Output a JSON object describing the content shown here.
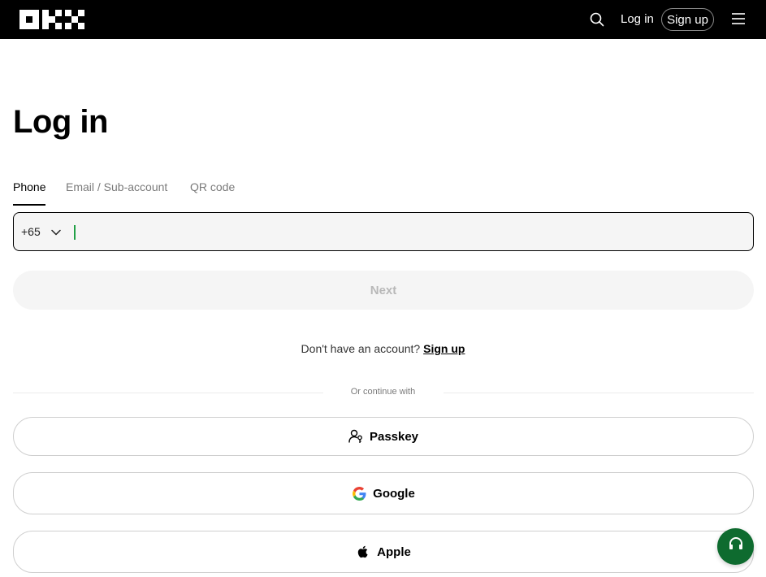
{
  "header": {
    "login_label": "Log in",
    "signup_label": "Sign up",
    "icons": [
      "okx-logo",
      "search-icon",
      "hamburger-menu-icon"
    ]
  },
  "main": {
    "title": "Log in",
    "tabs": [
      {
        "label": "Phone",
        "active": true
      },
      {
        "label": "Email / Sub-account",
        "active": false
      },
      {
        "label": "QR code",
        "active": false
      }
    ],
    "phone": {
      "country_code": "+65",
      "value": "",
      "placeholder": ""
    },
    "next_label": "Next",
    "signup_prompt": "Don't have an account?",
    "signup_link": "Sign up",
    "divider_text": "Or continue with",
    "social": [
      {
        "label": "Passkey",
        "icon": "passkey-icon"
      },
      {
        "label": "Google",
        "icon": "google-icon"
      },
      {
        "label": "Apple",
        "icon": "apple-icon"
      }
    ]
  },
  "colors": {
    "header_bg": "#000000",
    "accent_green": "#0e6b2f",
    "caret": "#21a046",
    "input_bg": "#f5f5f5"
  }
}
